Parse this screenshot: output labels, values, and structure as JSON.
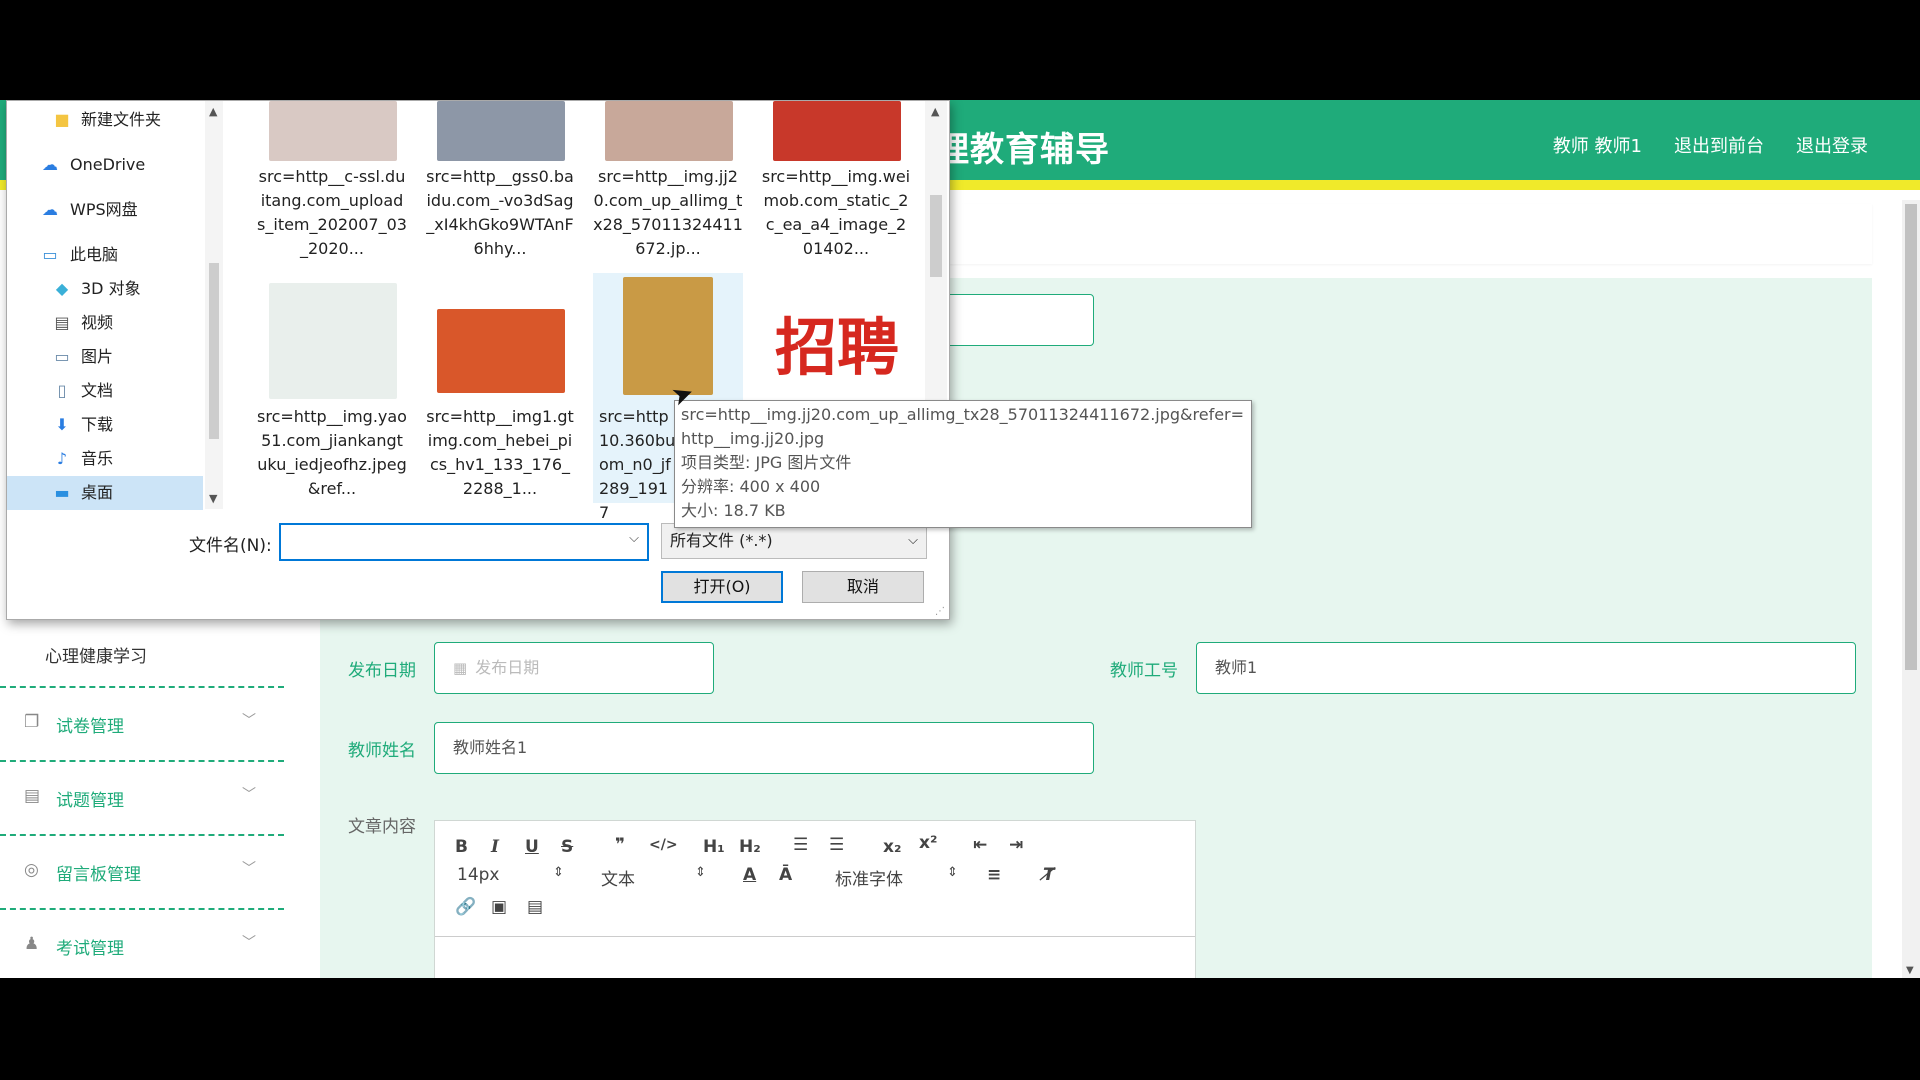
{
  "site": {
    "title": "理教育辅导",
    "links": [
      "教师 教师1",
      "退出到前台",
      "退出登录"
    ]
  },
  "sidebar": {
    "sub_item": "心理健康学习",
    "items": [
      {
        "label": "试卷管理",
        "icon": "copy-icon"
      },
      {
        "label": "试题管理",
        "icon": "clipboard-icon"
      },
      {
        "label": "留言板管理",
        "icon": "comment-icon"
      },
      {
        "label": "考试管理",
        "icon": "user-icon"
      }
    ]
  },
  "form": {
    "publish_date_label": "发布日期",
    "publish_date_placeholder": "发布日期",
    "teacher_id_label": "教师工号",
    "teacher_id_value": "教师1",
    "teacher_name_label": "教师姓名",
    "teacher_name_value": "教师姓名1",
    "content_label": "文章内容"
  },
  "editor": {
    "font_size": "14px",
    "block_type": "文本",
    "font_family": "标准字体",
    "tools": [
      "bold-icon",
      "italic-icon",
      "underline-icon",
      "strike-icon",
      "quote-icon",
      "code-icon",
      "h1-icon",
      "h2-icon",
      "ordered-list-icon",
      "bullet-list-icon",
      "subscript-icon",
      "superscript-icon",
      "outdent-icon",
      "indent-icon",
      "color-icon",
      "background-icon",
      "align-icon",
      "clear-format-icon",
      "link-icon",
      "image-icon",
      "video-icon"
    ]
  },
  "dialog": {
    "nav": [
      {
        "label": "新建文件夹",
        "icon": "folder-icon"
      },
      {
        "label": "OneDrive",
        "icon": "cloud-icon"
      },
      {
        "label": "WPS网盘",
        "icon": "wps-cloud-icon"
      },
      {
        "label": "此电脑",
        "icon": "computer-icon"
      },
      {
        "label": "3D 对象",
        "icon": "cube-icon"
      },
      {
        "label": "视频",
        "icon": "video-folder-icon"
      },
      {
        "label": "图片",
        "icon": "picture-folder-icon"
      },
      {
        "label": "文档",
        "icon": "document-folder-icon"
      },
      {
        "label": "下载",
        "icon": "download-icon"
      },
      {
        "label": "音乐",
        "icon": "music-icon"
      },
      {
        "label": "桌面",
        "icon": "desktop-icon"
      }
    ],
    "files": [
      {
        "name": "src=http__c-ssl.duitang.com_uploads_item_202007_03_2020...",
        "color": "#d9c9c4"
      },
      {
        "name": "src=http__gss0.baidu.com_-vo3dSag_xI4khGko9WTAnF6hhy...",
        "color": "#8d97a7"
      },
      {
        "name": "src=http__img.jj20.com_up_allimg_tx28_57011324411672.jp...",
        "color": "#c8a89a"
      },
      {
        "name": "src=http__img.weimob.com_static_2c_ea_a4_image_201402...",
        "color": "#c8382a"
      },
      {
        "name": "src=http__img.yao51.com_jiankangtuku_iedjeofhz.jpeg&ref...",
        "color": "#e9efec"
      },
      {
        "name": "src=http__img1.gtimg.com_hebei_pics_hv1_133_176_2288_1...",
        "color": "#d9572a"
      },
      {
        "name": "src=http10.360buom_n0_jf289_1917",
        "color": "#c99a45"
      },
      {
        "name": "",
        "color": "#ffffff"
      }
    ],
    "recruit_text": "招聘",
    "filename_label": "文件名(N):",
    "filename_value": "",
    "filter": "所有文件 (*.*)",
    "open_button": "打开(O)",
    "cancel_button": "取消"
  },
  "tooltip": {
    "line1": "src=http__img.jj20.com_up_allimg_tx28_57011324411672.jpg&refer=",
    "line2": "http__img.jj20.jpg",
    "line3": "项目类型: JPG 图片文件",
    "line4": "分辨率: 400 x 400",
    "line5": "大小: 18.7 KB"
  }
}
